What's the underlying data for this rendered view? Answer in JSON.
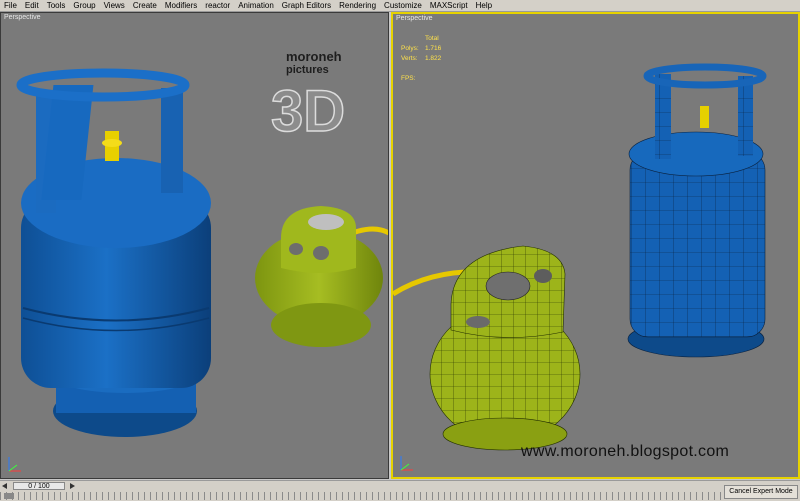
{
  "menu": [
    "File",
    "Edit",
    "Tools",
    "Group",
    "Views",
    "Create",
    "Modifiers",
    "reactor",
    "Animation",
    "Graph Editors",
    "Rendering",
    "Customize",
    "MAXScript",
    "Help"
  ],
  "viewport_left": {
    "label": "Perspective"
  },
  "viewport_right": {
    "label": "Perspective",
    "stats": {
      "header": "Total",
      "polys_label": "Polys:",
      "polys_value": "1.716",
      "verts_label": "Verts:",
      "verts_value": "1.822",
      "fps_label": "FPS:"
    }
  },
  "logo": {
    "line1": "moroneh",
    "line2": "pictures",
    "big": "3D"
  },
  "watermark_url": "www.moroneh.blogspot.com",
  "timeline": {
    "frame": "0 / 100"
  },
  "cancel_button": "Cancel Expert Mode",
  "colors": {
    "active_border": "#e6d200",
    "blue_tank": "#1565b8",
    "green_tank": "#9cb21a",
    "viewport_bg": "#7a7a7a"
  }
}
